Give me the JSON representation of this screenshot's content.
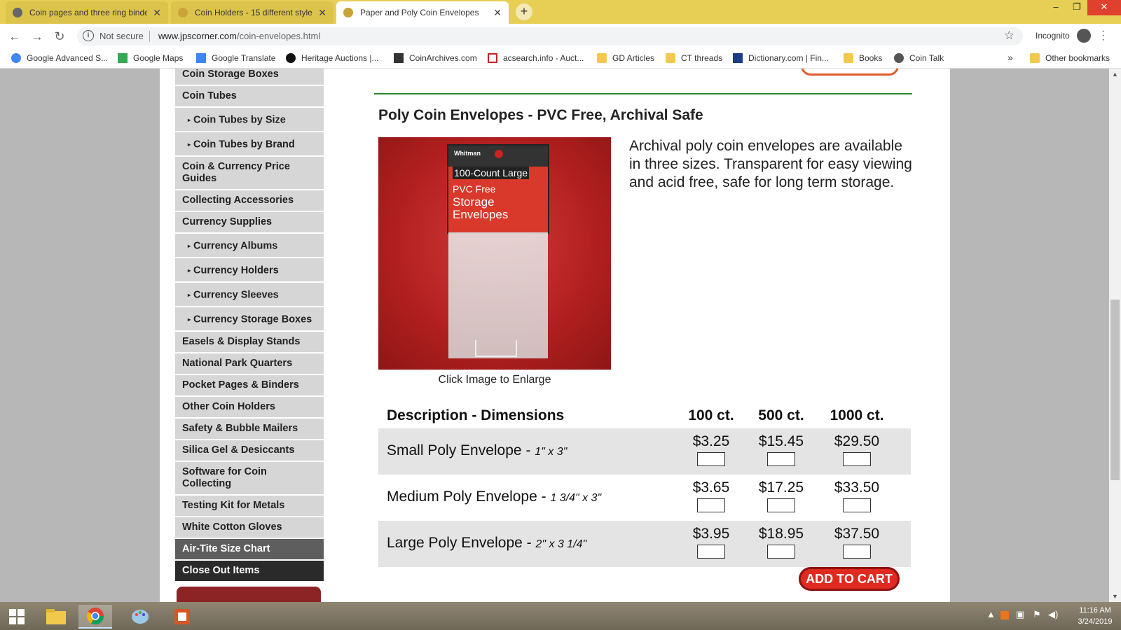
{
  "browser": {
    "tabs": [
      {
        "label": "Coin pages and three ring binder",
        "active": false
      },
      {
        "label": "Coin Holders - 15 different styles",
        "active": false
      },
      {
        "label": "Paper and Poly Coin Envelopes",
        "active": true
      }
    ],
    "new_tab_symbol": "+",
    "security_label": "Not secure",
    "url_host": "www.jpscorner.com",
    "url_path": "/coin-envelopes.html",
    "incognito_label": "Incognito",
    "bookmarks": [
      "Google Advanced S...",
      "Google Maps",
      "Google Translate",
      "Heritage Auctions |...",
      "CoinArchives.com",
      "acsearch.info - Auct...",
      "GD Articles",
      "CT threads",
      "Dictionary.com | Fin...",
      "Books",
      "Coin Talk"
    ],
    "bookmarks_overflow": "»",
    "other_bookmarks": "Other bookmarks"
  },
  "sidebar": {
    "items": [
      "Coin Storage Boxes",
      "Coin Tubes",
      "Coin Tubes by Size",
      "Coin Tubes by Brand",
      "Coin & Currency Price Guides",
      "Collecting Accessories",
      "Currency Supplies",
      "Currency Albums",
      "Currency Holders",
      "Currency Sleeves",
      "Currency Storage Boxes",
      "Easels & Display Stands",
      "National Park Quarters",
      "Pocket Pages & Binders",
      "Other Coin Holders",
      "Safety & Bubble Mailers",
      "Silica Gel & Desiccants",
      "Software for Coin Collecting",
      "Testing Kit for Metals",
      "White Cotton Gloves",
      "Air-Tite Size Chart",
      "Close Out Items"
    ],
    "rating_stars": "★★★★★"
  },
  "product": {
    "title": "Poly Coin Envelopes - PVC Free, Archival Safe",
    "image_caption": "Click Image to Enlarge",
    "image_text": {
      "brand": "Whitman",
      "count": "100-Count Large",
      "line1": "PVC Free",
      "line2": "Storage",
      "line3": "Envelopes"
    },
    "description": "Archival poly coin envelopes are available in three sizes. Transparent for easy viewing and acid free, safe for long term storage."
  },
  "price_table": {
    "headers": [
      "Description - Dimensions",
      "100 ct.",
      "500 ct.",
      "1000 ct."
    ],
    "rows": [
      {
        "name": "Small Poly Envelope",
        "dims": "1\" x 3\"",
        "prices": [
          "$3.25",
          "$15.45",
          "$29.50"
        ]
      },
      {
        "name": "Medium Poly Envelope",
        "dims": "1 3/4\" x 3\"",
        "prices": [
          "$3.65",
          "$17.25",
          "$33.50"
        ]
      },
      {
        "name": "Large Poly Envelope",
        "dims": "2\" x 3 1/4\"",
        "prices": [
          "$3.95",
          "$18.95",
          "$37.50"
        ]
      }
    ],
    "row_separator": " - "
  },
  "add_to_cart_label": "ADD TO CART",
  "taskbar": {
    "time": "11:16 AM",
    "date": "3/24/2019"
  }
}
